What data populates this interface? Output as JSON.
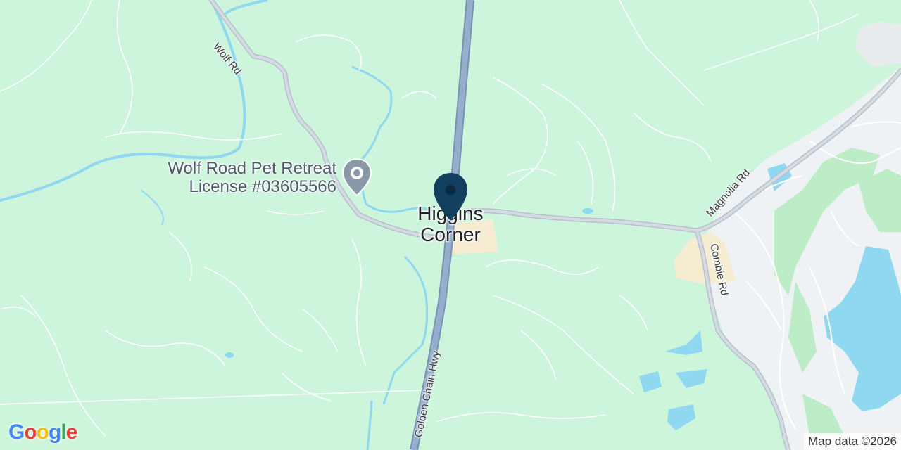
{
  "map": {
    "colors": {
      "land": "#cdf5dc",
      "park": "#bdedc6",
      "water": "#8fd8f0",
      "highway": "#8aa3c2",
      "road": "#c9d1da",
      "minor_road": "#ffffff",
      "urban": "#eef2f4",
      "settlement": "#f6ecd2",
      "pin": "#123f5e"
    },
    "roads": {
      "wolf_rd": "Wolf Rd",
      "magnolia_rd": "Magnolia Rd",
      "combie_rd": "Combie Rd",
      "golden_chain_hwy": "Golden Chain Hwy"
    },
    "poi": {
      "name_line1": "Wolf Road Pet Retreat",
      "name_line2": "License #03605566",
      "icon": "pin-poi-icon"
    },
    "place": {
      "line1": "Higgins",
      "line2": "Corner",
      "marker_icon": "location-pin-icon"
    },
    "attribution": "Map data ©2026",
    "logo": {
      "text": "Google"
    }
  }
}
